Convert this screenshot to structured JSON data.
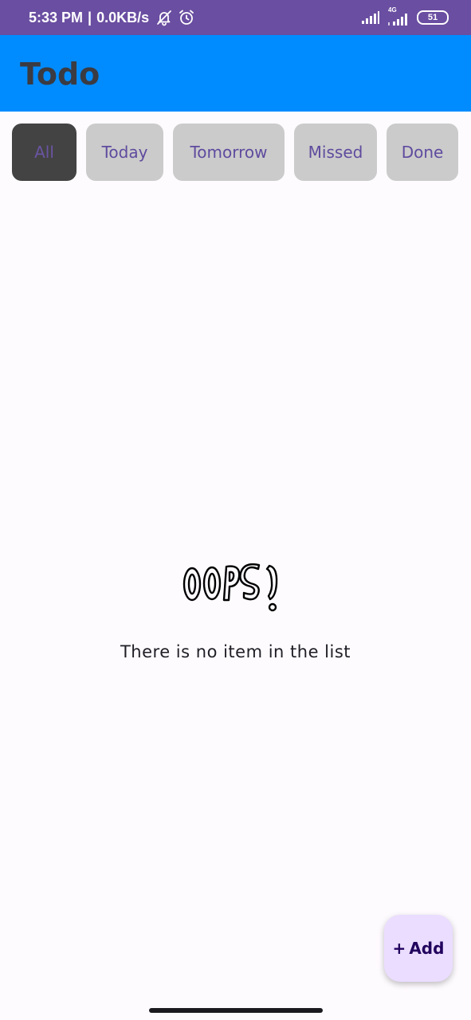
{
  "status_bar": {
    "time": "5:33 PM",
    "separator": "|",
    "speed": "0.0KB/s",
    "icons": [
      "mute-bell-icon",
      "alarm-icon",
      "signal-icon",
      "4g-signal-icon",
      "battery-icon"
    ],
    "network": "4G",
    "battery_level": "51",
    "bg_color": "#6a4ea1"
  },
  "app_bar": {
    "title": "Todo",
    "bg_color": "#008cff"
  },
  "filters": {
    "active": "All",
    "items": [
      {
        "label": "All"
      },
      {
        "label": "Today"
      },
      {
        "label": "Tomorrow"
      },
      {
        "label": "Missed"
      },
      {
        "label": "Done"
      }
    ]
  },
  "empty_state": {
    "illustration": "oops-lettering",
    "illustration_text": "OOPS!",
    "message": "There is no item in the list"
  },
  "fab": {
    "icon": "plus-icon",
    "plus": "+",
    "label": "Add",
    "bg_color": "#eaddff"
  }
}
